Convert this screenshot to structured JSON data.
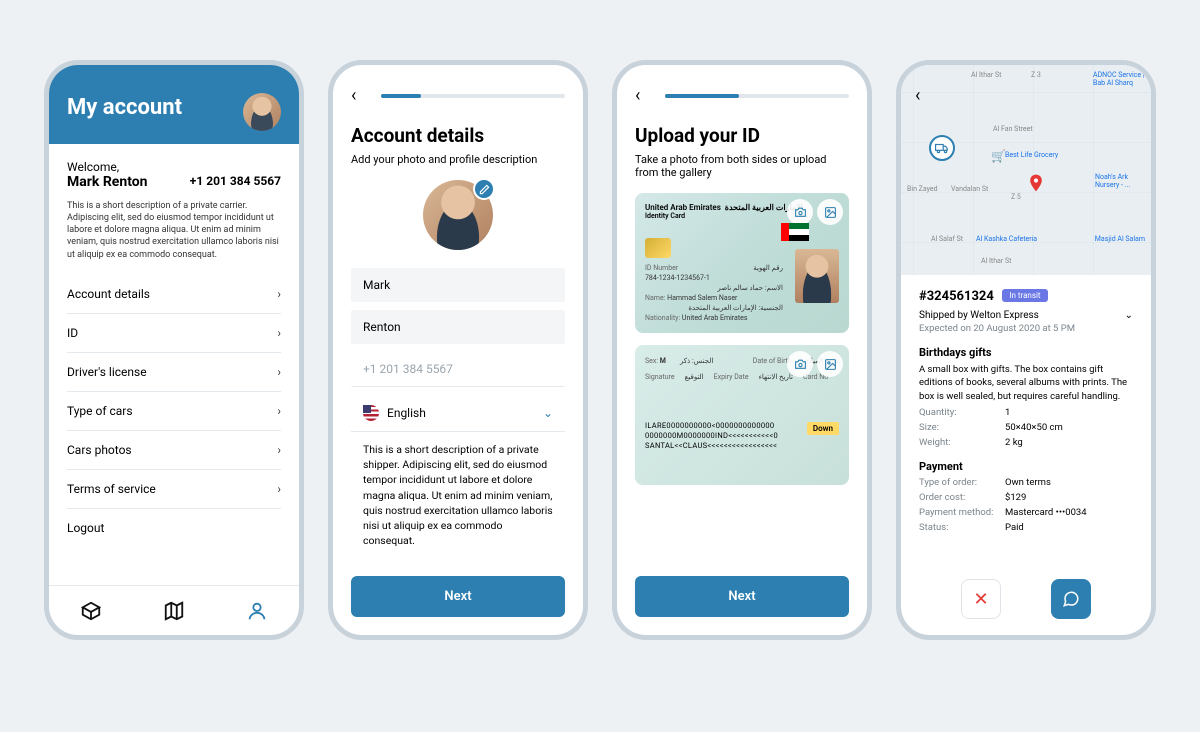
{
  "phone1": {
    "title": "My account",
    "welcome": "Welcome,",
    "name": "Mark Renton",
    "phone": "+1 201 384 5567",
    "desc": "This is a short description of a private carrier. Adipiscing elit, sed do eiusmod tempor incididunt ut labore et dolore magna aliqua. Ut enim ad minim veniam, quis nostrud exercitation ullamco laboris nisi ut aliquip ex ea commodo consequat.",
    "menu": [
      "Account details",
      "ID",
      "Driver's license",
      "Type of cars",
      "Cars photos",
      "Terms of service",
      "Logout"
    ]
  },
  "phone2": {
    "title": "Account details",
    "sub": "Add your photo and profile description",
    "first": "Mark",
    "last": "Renton",
    "phone_placeholder": "+1 201 384 5567",
    "lang": "English",
    "desc": "This is a short description of a private shipper. Adipiscing elit, sed do eiusmod tempor incididunt ut labore et dolore magna aliqua. Ut enim ad minim veniam, quis nostrud exercitation ullamco laboris nisi ut aliquip ex ea commodo consequat.",
    "next": "Next"
  },
  "phone3": {
    "title": "Upload your ID",
    "sub": "Take a photo from both sides or upload from the gallery",
    "card_country_en": "United Arab Emirates",
    "card_country_ar": "الإمارات العربية المتحدة",
    "card_type": "Identity Card",
    "idnum_label": "ID Number",
    "idnum_ar": "رقم الهوية",
    "idnum": "784-1234-1234567-1",
    "name_label": "Name:",
    "name_ar": "الاسم: حماد سالم ناصر",
    "name": "Hammad Salem Naser",
    "nat_label": "Nationality:",
    "nat_ar": "الجنسية: الإمارات العربية المتحدة",
    "nat": "United Arab Emirates",
    "sex_label": "Sex:",
    "sex": "M",
    "sex_ar": "الجنس: ذكر",
    "dob_label": "Date of Birth",
    "dob_ar": "تاريخ الميلاد",
    "sig_label": "Signature",
    "sig_ar": "التوقيع",
    "exp_label": "Expiry Date",
    "exp_ar": "تاريخ الانتهاء",
    "cardno_label": "Card No",
    "download": "Down",
    "mrz1": "ILARE0000000000<0000000000000",
    "mrz2": "0000000M0000000IND<<<<<<<<<<<0",
    "mrz3": "SANTAL<<CLAUS<<<<<<<<<<<<<<<<<",
    "next": "Next"
  },
  "phone4": {
    "order": "#324561324",
    "badge": "In transit",
    "shipped": "Shipped by Welton Express",
    "expected": "Expected on 20 August 2020 at 5 PM",
    "gift_title": "Birthdays gifts",
    "gift_desc": "A small box with gifts. The box contains gift editions of books, several albums with prints. The box is well sealed, but requires careful handling.",
    "qty_l": "Quantity:",
    "qty": "1",
    "size_l": "Size:",
    "size": "50×40×50 cm",
    "wt_l": "Weight:",
    "wt": "2 kg",
    "pay_title": "Payment",
    "type_l": "Type of order:",
    "type": "Own terms",
    "cost_l": "Order cost:",
    "cost": "$129",
    "method_l": "Payment method:",
    "method": "Mastercard •••0034",
    "status_l": "Status:",
    "status": "Paid",
    "map_labels": {
      "store": "Best Life Grocery",
      "l1": "Bin Zayed",
      "l2": "Z 3",
      "l3": "Z 5",
      "l4": "Al Fan Street",
      "l5": "Al Ithar St",
      "l6": "Vandalan St",
      "l7": "Al Salaf St",
      "l8": "Al Kashka Cafeteria",
      "l9": "Masjid Al Salam",
      "l10": "Noah's Ark Nursery - ...",
      "l11": "ADNOC Service | Bab Al Sharq",
      "l12": "Al Ithar St"
    }
  }
}
